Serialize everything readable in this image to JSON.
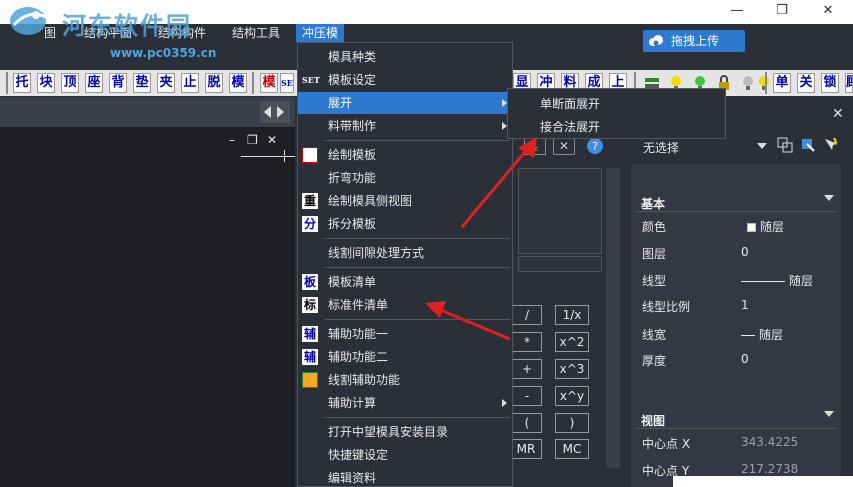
{
  "watermark": {
    "text": "河东软件园",
    "url": "www.pc0359.cn"
  },
  "menubar": {
    "items": [
      "结构平面",
      "结构构件",
      "结构工具",
      "冲压模"
    ],
    "partial_left": "图"
  },
  "upload": {
    "label": "拖拽上传"
  },
  "window_controls": {
    "minimize": "—",
    "maximize": "❐",
    "close": "✕"
  },
  "toolbar": {
    "left_glyphs": [
      "托",
      "块",
      "顶",
      "座",
      "背",
      "垫",
      "夹",
      "止",
      "脱",
      "模",
      "模"
    ],
    "set_label": "SET",
    "right_glyphs": [
      "显",
      "冲",
      "料",
      "成",
      "上"
    ],
    "far_right_glyphs": [
      "单",
      "关",
      "锁",
      "顾"
    ]
  },
  "canvas_controls": {
    "minimize": "–",
    "restore": "❐",
    "close": "✕"
  },
  "dropdown": {
    "items": [
      {
        "label": "模具种类",
        "icon": ""
      },
      {
        "label": "模板设定",
        "icon": "SET"
      },
      {
        "label": "展开",
        "icon": ""
      },
      {
        "label": "料带制作",
        "icon": ""
      },
      {
        "label": "绘制模板",
        "icon": ""
      },
      {
        "label": "折弯功能",
        "icon": ""
      },
      {
        "label": "绘制模具侧视图",
        "icon": "重"
      },
      {
        "label": "拆分模板",
        "icon": "分"
      },
      {
        "label": "线割间隙处理方式",
        "icon": ""
      },
      {
        "label": "模板清单",
        "icon": "板"
      },
      {
        "label": "标准件清单",
        "icon": "标"
      },
      {
        "label": "辅助功能一",
        "icon": "辅"
      },
      {
        "label": "辅助功能二",
        "icon": "辅"
      },
      {
        "label": "线割辅助功能",
        "icon": ""
      },
      {
        "label": "辅助计算",
        "icon": ""
      },
      {
        "label": "打开中望模具安装目录",
        "icon": ""
      },
      {
        "label": "快捷键设定",
        "icon": ""
      },
      {
        "label": "编辑资料",
        "icon": ""
      }
    ]
  },
  "submenu": {
    "items": [
      "单断面展开",
      "接合法展开"
    ]
  },
  "calculator": {
    "keys": [
      "/",
      "1/x",
      "*",
      "x^2",
      "+",
      "x^3",
      "-",
      "x^y",
      "(",
      ")",
      "MR",
      "MC"
    ]
  },
  "properties": {
    "selection": "无选择",
    "basic_section": "基本",
    "rows": [
      {
        "label": "颜色",
        "value": "随层"
      },
      {
        "label": "图层",
        "value": "0"
      },
      {
        "label": "线型",
        "value": "随层"
      },
      {
        "label": "线型比例",
        "value": "1"
      },
      {
        "label": "线宽",
        "value": "随层"
      },
      {
        "label": "厚度",
        "value": "0"
      }
    ],
    "view_section": "视图",
    "view_rows": [
      {
        "label": "中心点 X",
        "value": "343.4225"
      },
      {
        "label": "中心点 Y",
        "value": "217.2738"
      }
    ]
  },
  "colors": {
    "accent": "#2f7ad1",
    "arrow": "#e02020",
    "panel": "#2b3038"
  }
}
